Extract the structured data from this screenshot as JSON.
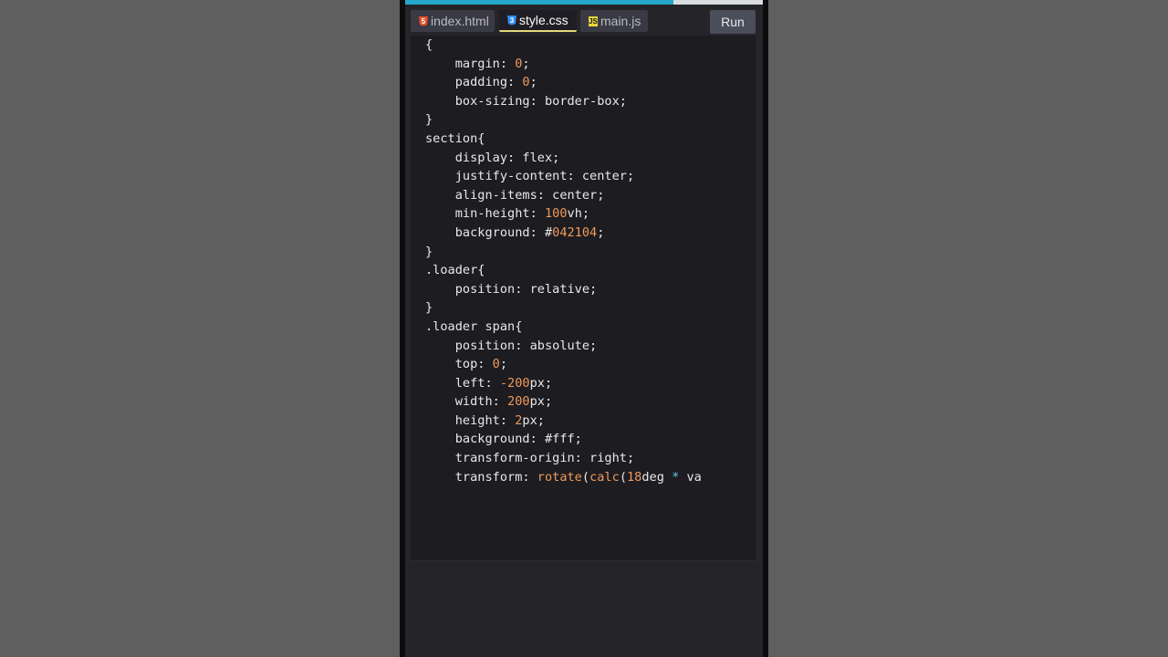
{
  "tabs": [
    {
      "label": "index.html",
      "icon": "html5-icon",
      "active": false
    },
    {
      "label": "style.css",
      "icon": "css3-icon",
      "active": true
    },
    {
      "label": "main.js",
      "icon": "js-icon",
      "active": false
    }
  ],
  "run_label": "Run",
  "progress": 0.75,
  "colors": {
    "accent": "#27a6c9",
    "number": "#ef9a5a",
    "operator": "#63c8e6",
    "active_tab_underline": "#e3d97b"
  },
  "code_lines": [
    [
      {
        "t": "{",
        "c": ""
      }
    ],
    [
      {
        "t": "    margin: ",
        "c": ""
      },
      {
        "t": "0",
        "c": "num"
      },
      {
        "t": ";",
        "c": ""
      }
    ],
    [
      {
        "t": "    padding: ",
        "c": ""
      },
      {
        "t": "0",
        "c": "num"
      },
      {
        "t": ";",
        "c": ""
      }
    ],
    [
      {
        "t": "    box-sizing: border-box;",
        "c": ""
      }
    ],
    [
      {
        "t": "}",
        "c": ""
      }
    ],
    [
      {
        "t": "section{",
        "c": ""
      }
    ],
    [
      {
        "t": "    display: flex;",
        "c": ""
      }
    ],
    [
      {
        "t": "    justify-content: center;",
        "c": ""
      }
    ],
    [
      {
        "t": "    align-items: center;",
        "c": ""
      }
    ],
    [
      {
        "t": "    min-height: ",
        "c": ""
      },
      {
        "t": "100",
        "c": "num"
      },
      {
        "t": "vh;",
        "c": ""
      }
    ],
    [
      {
        "t": "    background: #",
        "c": ""
      },
      {
        "t": "042104",
        "c": "num"
      },
      {
        "t": ";",
        "c": ""
      }
    ],
    [
      {
        "t": "}",
        "c": ""
      }
    ],
    [
      {
        "t": ".loader{",
        "c": ""
      }
    ],
    [
      {
        "t": "    position: relative;",
        "c": ""
      }
    ],
    [
      {
        "t": "}",
        "c": ""
      }
    ],
    [
      {
        "t": ".loader span{",
        "c": ""
      }
    ],
    [
      {
        "t": "    position: absolute;",
        "c": ""
      }
    ],
    [
      {
        "t": "    top: ",
        "c": ""
      },
      {
        "t": "0",
        "c": "num"
      },
      {
        "t": ";",
        "c": ""
      }
    ],
    [
      {
        "t": "    left: ",
        "c": ""
      },
      {
        "t": "-200",
        "c": "num"
      },
      {
        "t": "px;",
        "c": ""
      }
    ],
    [
      {
        "t": "    width: ",
        "c": ""
      },
      {
        "t": "200",
        "c": "num"
      },
      {
        "t": "px;",
        "c": ""
      }
    ],
    [
      {
        "t": "    height: ",
        "c": ""
      },
      {
        "t": "2",
        "c": "num"
      },
      {
        "t": "px;",
        "c": ""
      }
    ],
    [
      {
        "t": "    background: #fff;",
        "c": ""
      }
    ],
    [
      {
        "t": "    transform-origin: right;",
        "c": ""
      }
    ],
    [
      {
        "t": "    transform: ",
        "c": ""
      },
      {
        "t": "rotate",
        "c": "fn"
      },
      {
        "t": "(",
        "c": ""
      },
      {
        "t": "calc",
        "c": "fn"
      },
      {
        "t": "(",
        "c": ""
      },
      {
        "t": "18",
        "c": "num"
      },
      {
        "t": "deg ",
        "c": ""
      },
      {
        "t": "*",
        "c": "op"
      },
      {
        "t": " va",
        "c": ""
      }
    ]
  ]
}
